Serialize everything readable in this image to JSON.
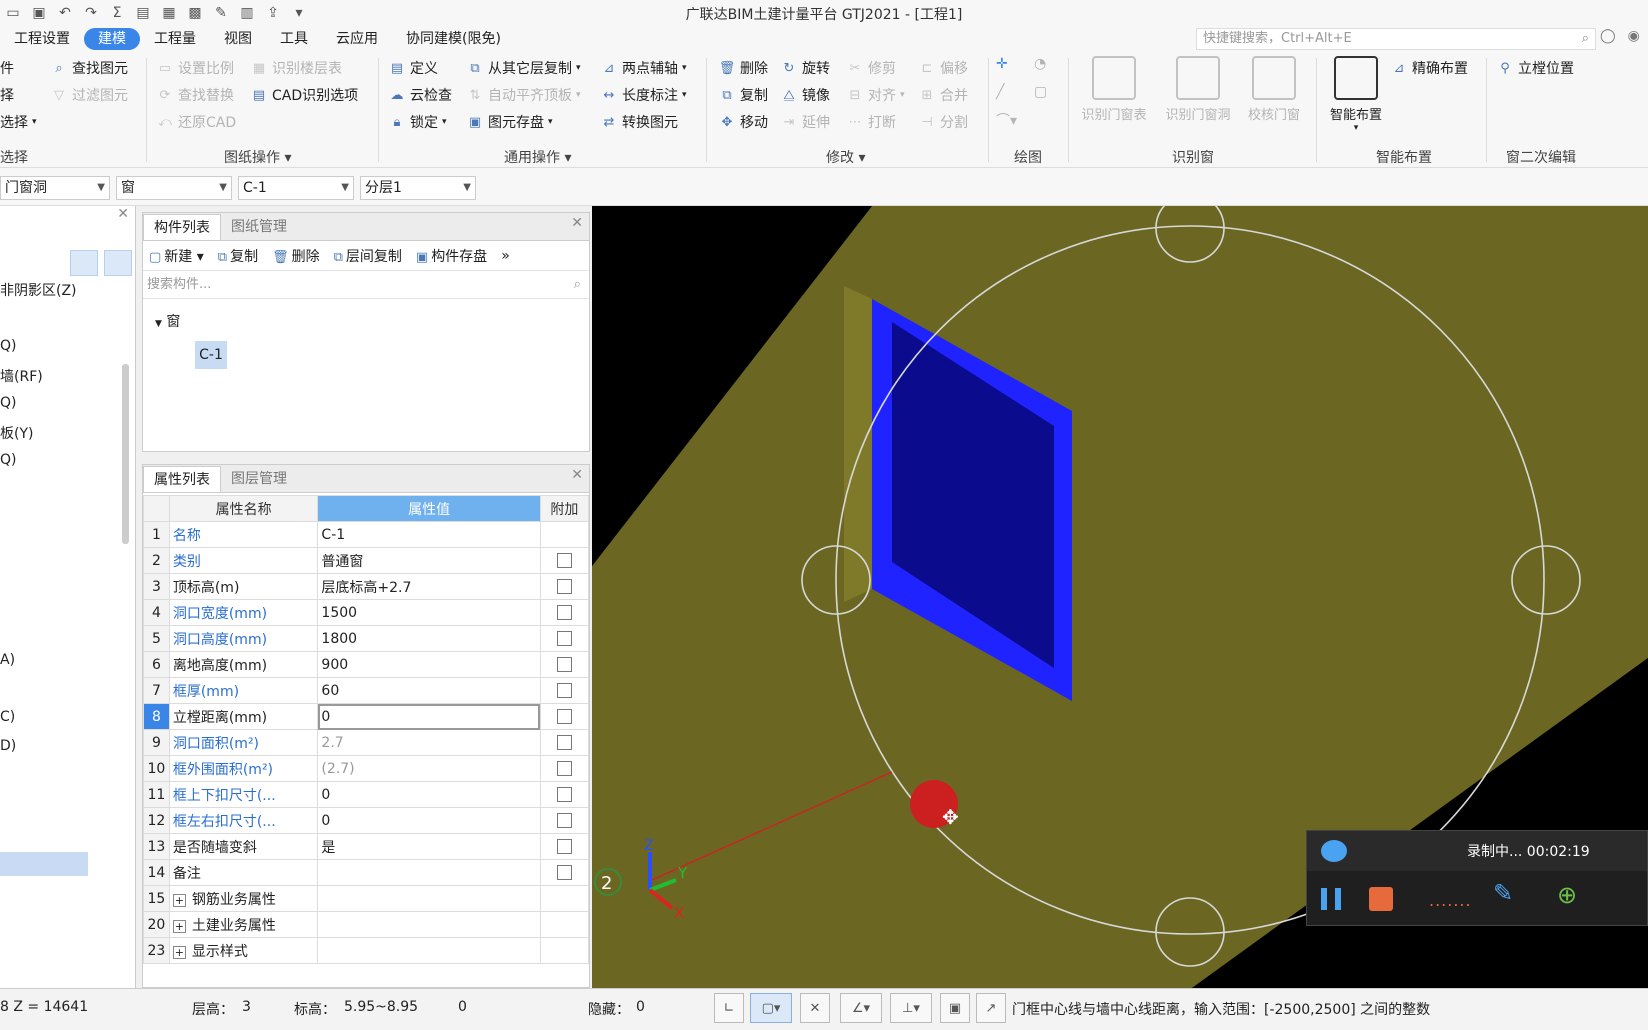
{
  "titlebar": {
    "title": "广联达BIM土建计量平台 GTJ2021 - [工程1]"
  },
  "menu": {
    "items": [
      "工程设置",
      "建模",
      "工程量",
      "视图",
      "工具",
      "云应用",
      "协同建模(限免)"
    ],
    "active_index": 1
  },
  "search": {
    "placeholder": "快捷键搜索，Ctrl+Alt+E"
  },
  "ribbon": {
    "col0": [
      "件",
      "择",
      "选择",
      "选择"
    ],
    "col1": [
      "查找图元",
      "过滤图元"
    ],
    "drawing": [
      "设置比例",
      "识别楼层表",
      "查找替换",
      "CAD识别选项",
      "还原CAD"
    ],
    "drawing_group": "图纸操作",
    "common": [
      "定义",
      "从其它层复制",
      "两点辅轴",
      "云检查",
      "自动平齐顶板",
      "长度标注",
      "锁定",
      "图元存盘",
      "转换图元"
    ],
    "common_group": "通用操作",
    "modify": [
      "删除",
      "旋转",
      "修剪",
      "偏移",
      "复制",
      "镜像",
      "对齐",
      "合并",
      "移动",
      "延伸",
      "打断",
      "分割"
    ],
    "modify_group": "修改",
    "draw_group": "绘图",
    "recog": [
      "识别门窗表",
      "识别门窗洞",
      "校核门窗"
    ],
    "recog_group": "识别窗",
    "smart": [
      "智能布置",
      "精确布置"
    ],
    "smart_group": "智能布置",
    "second": [
      "立樘位置"
    ],
    "second_group": "窗二次编辑"
  },
  "filters": {
    "f1": "门窗洞",
    "f2": "窗",
    "f3": "C-1",
    "f4": "分层1"
  },
  "left": {
    "items": [
      "非阴影区(Z)",
      "Q)",
      "墙(RF)",
      "Q)",
      "板(Y)",
      "Q)",
      "A)",
      "C)",
      "D)"
    ]
  },
  "component": {
    "tabs": [
      "构件列表",
      "图纸管理"
    ],
    "toolbar": [
      "新建",
      "复制",
      "删除",
      "层间复制",
      "构件存盘"
    ],
    "search_placeholder": "搜索构件...",
    "tree_root": "窗",
    "tree_child": "C-1"
  },
  "props": {
    "tabs": [
      "属性列表",
      "图层管理"
    ],
    "headers": [
      "属性名称",
      "属性值",
      "附加"
    ],
    "rows": [
      {
        "n": "1",
        "name": "名称",
        "val": "C-1",
        "blue": true,
        "cb": false
      },
      {
        "n": "2",
        "name": "类别",
        "val": "普通窗",
        "blue": true,
        "cb": true
      },
      {
        "n": "3",
        "name": "顶标高(m)",
        "val": "层底标高+2.7",
        "blue": false,
        "cb": true
      },
      {
        "n": "4",
        "name": "洞口宽度(mm)",
        "val": "1500",
        "blue": true,
        "cb": true
      },
      {
        "n": "5",
        "name": "洞口高度(mm)",
        "val": "1800",
        "blue": true,
        "cb": true
      },
      {
        "n": "6",
        "name": "离地高度(mm)",
        "val": "900",
        "blue": false,
        "cb": true
      },
      {
        "n": "7",
        "name": "框厚(mm)",
        "val": "60",
        "blue": true,
        "cb": true
      },
      {
        "n": "8",
        "name": "立樘距离(mm)",
        "val": "0",
        "blue": false,
        "cb": true
      },
      {
        "n": "9",
        "name": "洞口面积(m²)",
        "val": "2.7",
        "blue": true,
        "cb": true
      },
      {
        "n": "10",
        "name": "框外围面积(m²)",
        "val": "(2.7)",
        "blue": true,
        "cb": true
      },
      {
        "n": "11",
        "name": "框上下扣尺寸(...",
        "val": "0",
        "blue": true,
        "cb": true
      },
      {
        "n": "12",
        "name": "框左右扣尺寸(...",
        "val": "0",
        "blue": true,
        "cb": true
      },
      {
        "n": "13",
        "name": "是否随墙变斜",
        "val": "是",
        "blue": false,
        "cb": true
      },
      {
        "n": "14",
        "name": "备注",
        "val": "",
        "blue": false,
        "cb": true
      },
      {
        "n": "15",
        "name": "钢筋业务属性",
        "val": "",
        "blue": false,
        "cb": false
      },
      {
        "n": "20",
        "name": "土建业务属性",
        "val": "",
        "blue": false,
        "cb": false
      },
      {
        "n": "23",
        "name": "显示样式",
        "val": "",
        "blue": false,
        "cb": false
      }
    ]
  },
  "viewport": {
    "axis_num": "2",
    "axis_y": "Y",
    "axis_x": "X",
    "axis_z": "Z"
  },
  "recorder": {
    "status": "录制中... 00:02:19"
  },
  "status": {
    "coord": "8 Z = 14641",
    "floor_label": "层高：",
    "floor": "3",
    "elev_label": "标高：",
    "elev": "5.95~8.95",
    "zero": "0",
    "hidden_label": "隐藏：",
    "hidden": "0",
    "hint": "门框中心线与墙中心线距离，输入范围：[-2500,2500] 之间的整数"
  }
}
